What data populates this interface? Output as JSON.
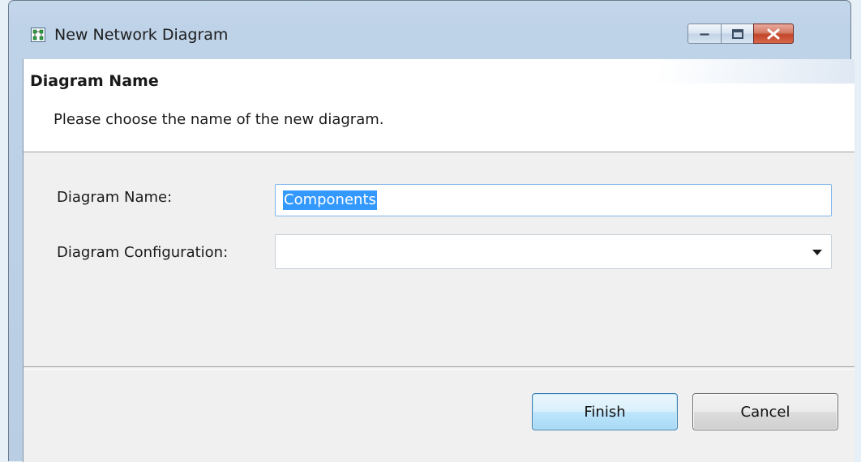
{
  "window": {
    "title": "New Network Diagram",
    "icon": "network-diagram-icon"
  },
  "caption_buttons": {
    "minimize_icon": "minimize-icon",
    "maximize_icon": "maximize-icon",
    "close_icon": "close-icon",
    "close_color": "#c2452b"
  },
  "header": {
    "title": "Diagram Name",
    "description": "Please choose the name of the new diagram."
  },
  "form": {
    "name_label": "Diagram Name:",
    "name_value": "Components",
    "config_label": "Diagram Configuration:",
    "config_value": ""
  },
  "buttons": {
    "finish_label": "Finish",
    "cancel_label": "Cancel"
  },
  "colors": {
    "selection": "#3399ff",
    "default_button_border": "#3c7fb1"
  }
}
